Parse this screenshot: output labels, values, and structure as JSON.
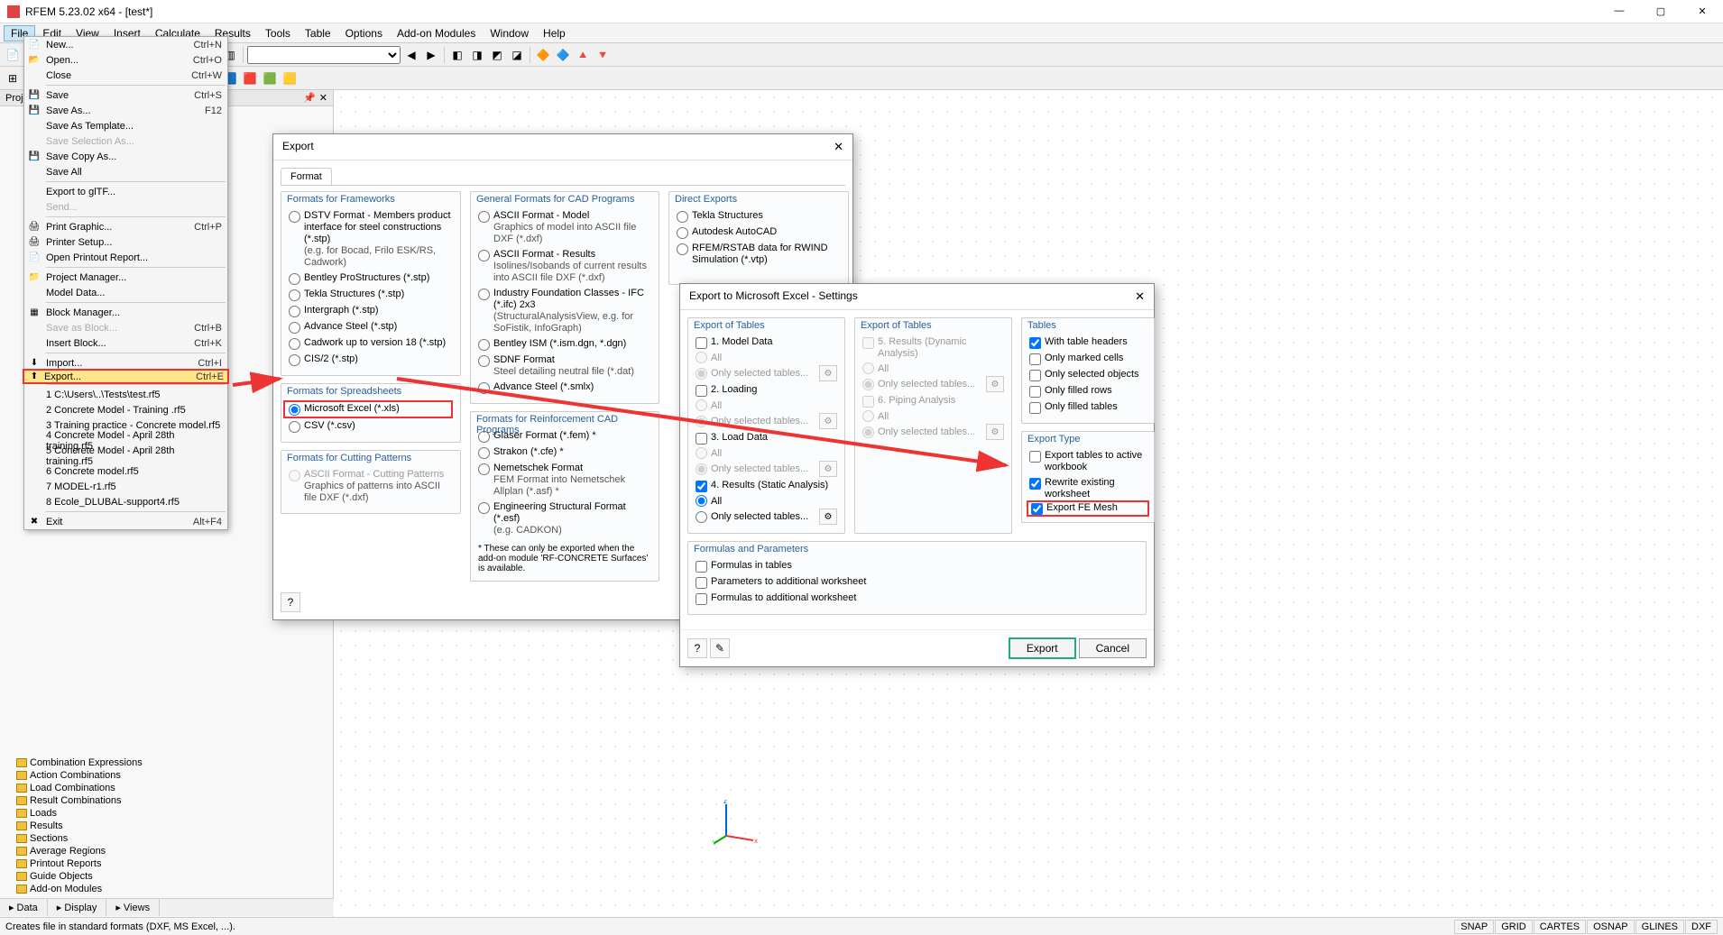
{
  "app": {
    "title": "RFEM 5.23.02 x64 - [test*]"
  },
  "menu": {
    "items": [
      "File",
      "Edit",
      "View",
      "Insert",
      "Calculate",
      "Results",
      "Tools",
      "Table",
      "Options",
      "Add-on Modules",
      "Window",
      "Help"
    ]
  },
  "filemenu": [
    {
      "icon": "📄",
      "label": "New...",
      "sc": "Ctrl+N"
    },
    {
      "icon": "📂",
      "label": "Open...",
      "sc": "Ctrl+O"
    },
    {
      "icon": "",
      "label": "Close",
      "sc": "Ctrl+W"
    },
    {
      "sep": true
    },
    {
      "icon": "💾",
      "label": "Save",
      "sc": "Ctrl+S"
    },
    {
      "icon": "💾",
      "label": "Save As...",
      "sc": "F12"
    },
    {
      "icon": "",
      "label": "Save As Template..."
    },
    {
      "icon": "",
      "label": "Save Selection As...",
      "disabled": true
    },
    {
      "icon": "💾",
      "label": "Save Copy As..."
    },
    {
      "icon": "",
      "label": "Save All"
    },
    {
      "sep": true
    },
    {
      "icon": "",
      "label": "Export to glTF..."
    },
    {
      "icon": "",
      "label": "Send...",
      "disabled": true
    },
    {
      "sep": true
    },
    {
      "icon": "🖨",
      "label": "Print Graphic...",
      "sc": "Ctrl+P"
    },
    {
      "icon": "🖨",
      "label": "Printer Setup..."
    },
    {
      "icon": "📄",
      "label": "Open Printout Report..."
    },
    {
      "sep": true
    },
    {
      "icon": "📁",
      "label": "Project Manager..."
    },
    {
      "icon": "",
      "label": "Model Data..."
    },
    {
      "sep": true
    },
    {
      "icon": "▦",
      "label": "Block Manager..."
    },
    {
      "icon": "",
      "label": "Save as Block...",
      "sc": "Ctrl+B",
      "disabled": true
    },
    {
      "icon": "",
      "label": "Insert Block...",
      "sc": "Ctrl+K"
    },
    {
      "sep": true
    },
    {
      "icon": "⬇",
      "label": "Import...",
      "sc": "Ctrl+I"
    },
    {
      "icon": "⬆",
      "label": "Export...",
      "sc": "Ctrl+E",
      "hl": true
    },
    {
      "sep": true
    },
    {
      "icon": "",
      "label": "1 C:\\Users\\..\\Tests\\test.rf5"
    },
    {
      "icon": "",
      "label": "2 Concrete Model - Training .rf5"
    },
    {
      "icon": "",
      "label": "3 Training practice - Concrete model.rf5"
    },
    {
      "icon": "",
      "label": "4 Concrete Model - April 28th training.rf5"
    },
    {
      "icon": "",
      "label": "5 Concrete Model - April 28th training.rf5"
    },
    {
      "icon": "",
      "label": "6 Concrete model.rf5"
    },
    {
      "icon": "",
      "label": "7 MODEL-r1.rf5"
    },
    {
      "icon": "",
      "label": "8 Ecole_DLUBAL-support4.rf5"
    },
    {
      "sep": true
    },
    {
      "icon": "✖",
      "label": "Exit",
      "sc": "Alt+F4"
    }
  ],
  "exportDialog": {
    "title": "Export",
    "tab": "Format",
    "groups": {
      "frameworks": {
        "title": "Formats for Frameworks",
        "items": [
          {
            "label": "DSTV Format - Members product interface for steel constructions (*.stp)",
            "sub": "(e.g. for Bocad, Frilo ESK/RS, Cadwork)"
          },
          {
            "label": "Bentley ProStructures (*.stp)"
          },
          {
            "label": "Tekla Structures (*.stp)"
          },
          {
            "label": "Intergraph (*.stp)"
          },
          {
            "label": "Advance Steel (*.stp)"
          },
          {
            "label": "Cadwork up to version 18 (*.stp)"
          },
          {
            "label": "CIS/2 (*.stp)"
          }
        ]
      },
      "spreadsheets": {
        "title": "Formats for Spreadsheets",
        "items": [
          {
            "label": "Microsoft Excel (*.xls)",
            "checked": true,
            "hl": true
          },
          {
            "label": "CSV (*.csv)"
          }
        ]
      },
      "cutting": {
        "title": "Formats for Cutting Patterns",
        "items": [
          {
            "label": "ASCII Format - Cutting Patterns",
            "sub": "Graphics of patterns into ASCII file DXF (*.dxf)",
            "disabled": true
          }
        ]
      },
      "cad": {
        "title": "General Formats for CAD Programs",
        "items": [
          {
            "label": "ASCII Format - Model",
            "sub": "Graphics of model into ASCII file DXF (*.dxf)"
          },
          {
            "label": "ASCII Format - Results",
            "sub": "Isolines/Isobands of current results into ASCII file DXF (*.dxf)"
          },
          {
            "label": "Industry Foundation Classes - IFC (*.ifc) 2x3",
            "sub": "(StructuralAnalysisView, e.g. for SoFistik, InfoGraph)"
          },
          {
            "label": "Bentley ISM (*.ism.dgn, *.dgn)"
          },
          {
            "label": "SDNF Format",
            "sub": "Steel detailing neutral file (*.dat)"
          },
          {
            "label": "Advance Steel (*.smlx)"
          }
        ]
      },
      "reinf": {
        "title": "Formats for Reinforcement CAD Programs",
        "items": [
          {
            "label": "Glaser Format (*.fem)  *"
          },
          {
            "label": "Strakon (*.cfe)  *"
          },
          {
            "label": "Nemetschek Format",
            "sub": "FEM Format into Nemetschek Allplan (*.asf)  *"
          },
          {
            "label": "Engineering Structural Format (*.esf)",
            "sub": "(e.g. CADKON)"
          }
        ],
        "note": "*  These can only be exported when the add-on module 'RF-CONCRETE Surfaces' is available."
      },
      "direct": {
        "title": "Direct Exports",
        "items": [
          {
            "label": "Tekla Structures"
          },
          {
            "label": "Autodesk AutoCAD"
          },
          {
            "label": "RFEM/RSTAB data for RWIND Simulation (*.vtp)"
          }
        ]
      }
    }
  },
  "excelDialog": {
    "title": "Export to Microsoft Excel - Settings",
    "tablesA": {
      "title": "Export of Tables",
      "groups": [
        {
          "label": "1. Model Data",
          "checked": false,
          "opts": [
            "All",
            "Only selected tables..."
          ],
          "sel": 1
        },
        {
          "label": "2. Loading",
          "checked": false,
          "opts": [
            "All",
            "Only selected tables..."
          ],
          "sel": 1
        },
        {
          "label": "3. Load Data",
          "checked": false,
          "opts": [
            "All",
            "Only selected tables..."
          ],
          "sel": 1
        },
        {
          "label": "4. Results (Static Analysis)",
          "checked": true,
          "opts": [
            "All",
            "Only selected tables..."
          ],
          "sel": 0
        }
      ]
    },
    "tablesB": {
      "title": "Export of Tables",
      "groups": [
        {
          "label": "5. Results (Dynamic Analysis)",
          "disabled": true,
          "opts": [
            "All",
            "Only selected tables..."
          ],
          "sel": 1
        },
        {
          "label": "6. Piping Analysis",
          "disabled": true,
          "opts": [
            "All",
            "Only selected tables..."
          ],
          "sel": 1
        }
      ]
    },
    "tablesC": {
      "title": "Tables",
      "items": [
        {
          "label": "With table headers",
          "checked": true
        },
        {
          "label": "Only marked cells"
        },
        {
          "label": "Only selected objects"
        },
        {
          "label": "Only filled rows"
        },
        {
          "label": "Only filled tables"
        }
      ]
    },
    "exportType": {
      "title": "Export Type",
      "items": [
        {
          "label": "Export tables to active workbook"
        },
        {
          "label": "Rewrite existing worksheet",
          "checked": true
        },
        {
          "label": "Export FE Mesh",
          "checked": true,
          "hl": true
        }
      ]
    },
    "formulas": {
      "title": "Formulas and Parameters",
      "items": [
        {
          "label": "Formulas in tables"
        },
        {
          "label": "Parameters to additional worksheet"
        },
        {
          "label": "Formulas to additional worksheet"
        }
      ]
    },
    "buttons": {
      "export": "Export",
      "cancel": "Cancel"
    }
  },
  "tree": {
    "items": [
      "Combination Expressions",
      "Action Combinations",
      "Load Combinations",
      "Result Combinations",
      "Loads",
      "Results",
      "Sections",
      "Average Regions",
      "Printout Reports",
      "Guide Objects",
      "Add-on Modules"
    ]
  },
  "bottomTabs": [
    "Data",
    "Display",
    "Views"
  ],
  "status": {
    "left": "Creates file in standard formats (DXF, MS Excel, ...).",
    "right": [
      "SNAP",
      "GRID",
      "CARTES",
      "OSNAP",
      "GLINES",
      "DXF"
    ]
  },
  "panel": {
    "title": "Proje...",
    "blank": " "
  }
}
